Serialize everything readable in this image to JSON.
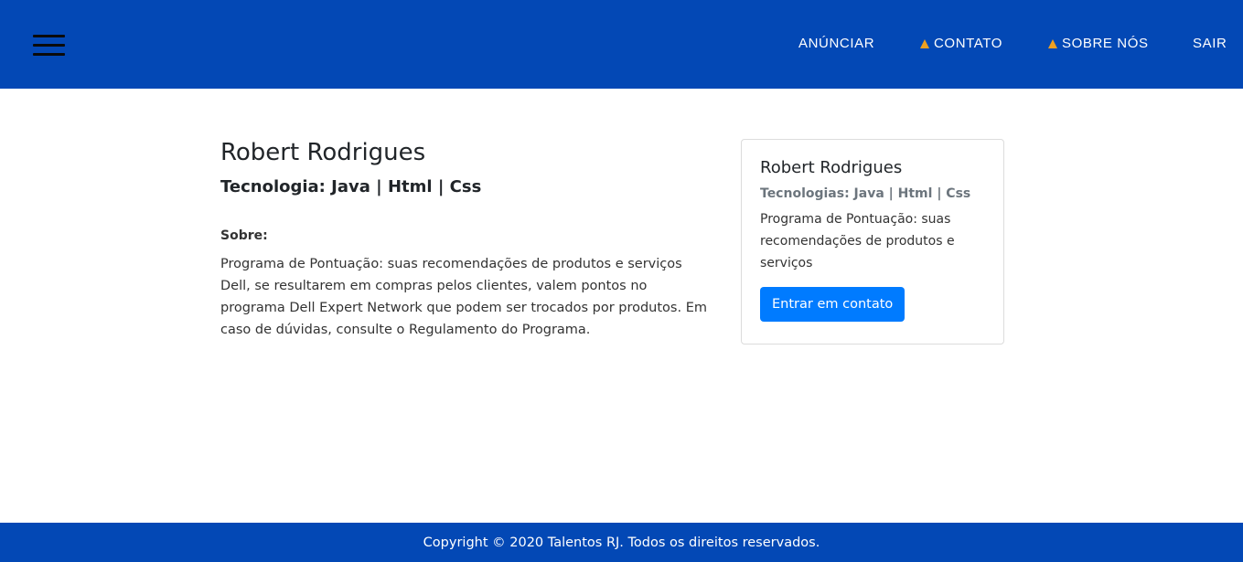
{
  "navbar": {
    "menu_icon": "hamburger-icon",
    "links": [
      {
        "label": "ANÚNCIAR",
        "icon": ""
      },
      {
        "label": "CONTATO",
        "icon": "warning-icon"
      },
      {
        "label": "SOBRE NÓS",
        "icon": "warning-icon"
      },
      {
        "label": "SAIR",
        "icon": ""
      }
    ],
    "background": "#0348b5"
  },
  "profile": {
    "name": "Robert Rodrigues",
    "tech": "Tecnologia: Java | Html | Css",
    "about_label": "Sobre:",
    "about_text": "Programa de Pontuação: suas recomendações de produtos e serviços Dell, se resultarem em compras pelos clientes, valem pontos no programa Dell Expert Network que podem ser trocados por produtos. Em caso de dúvidas, consulte o Regulamento do Programa."
  },
  "card": {
    "title": "Robert Rodrigues",
    "subtitle": "Tecnologias: Java | Html | Css",
    "text": "Programa de Pontuação: suas recomendações de produtos e serviços",
    "button_label": "Entrar em contato",
    "button_color": "#007bff"
  },
  "footer": {
    "copyright": "Copyright © 2020 Talentos RJ. Todos os direitos reservados."
  }
}
